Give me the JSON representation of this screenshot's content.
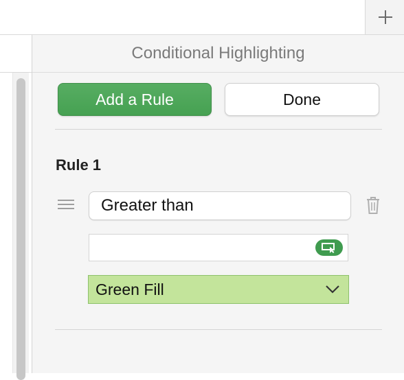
{
  "toolbar": {
    "add_icon": "plus-icon"
  },
  "panel": {
    "title": "Conditional Highlighting",
    "add_rule_label": "Add a Rule",
    "done_label": "Done"
  },
  "rule": {
    "title": "Rule 1",
    "condition": "Greater than",
    "value": "",
    "style": "Green Fill",
    "icons": [
      "drag-handle-icon",
      "trash-icon",
      "cell-reference-icon",
      "chevron-down-icon"
    ]
  },
  "colors": {
    "accent_green": "#46a152",
    "fill_green": "#c3e49b"
  }
}
